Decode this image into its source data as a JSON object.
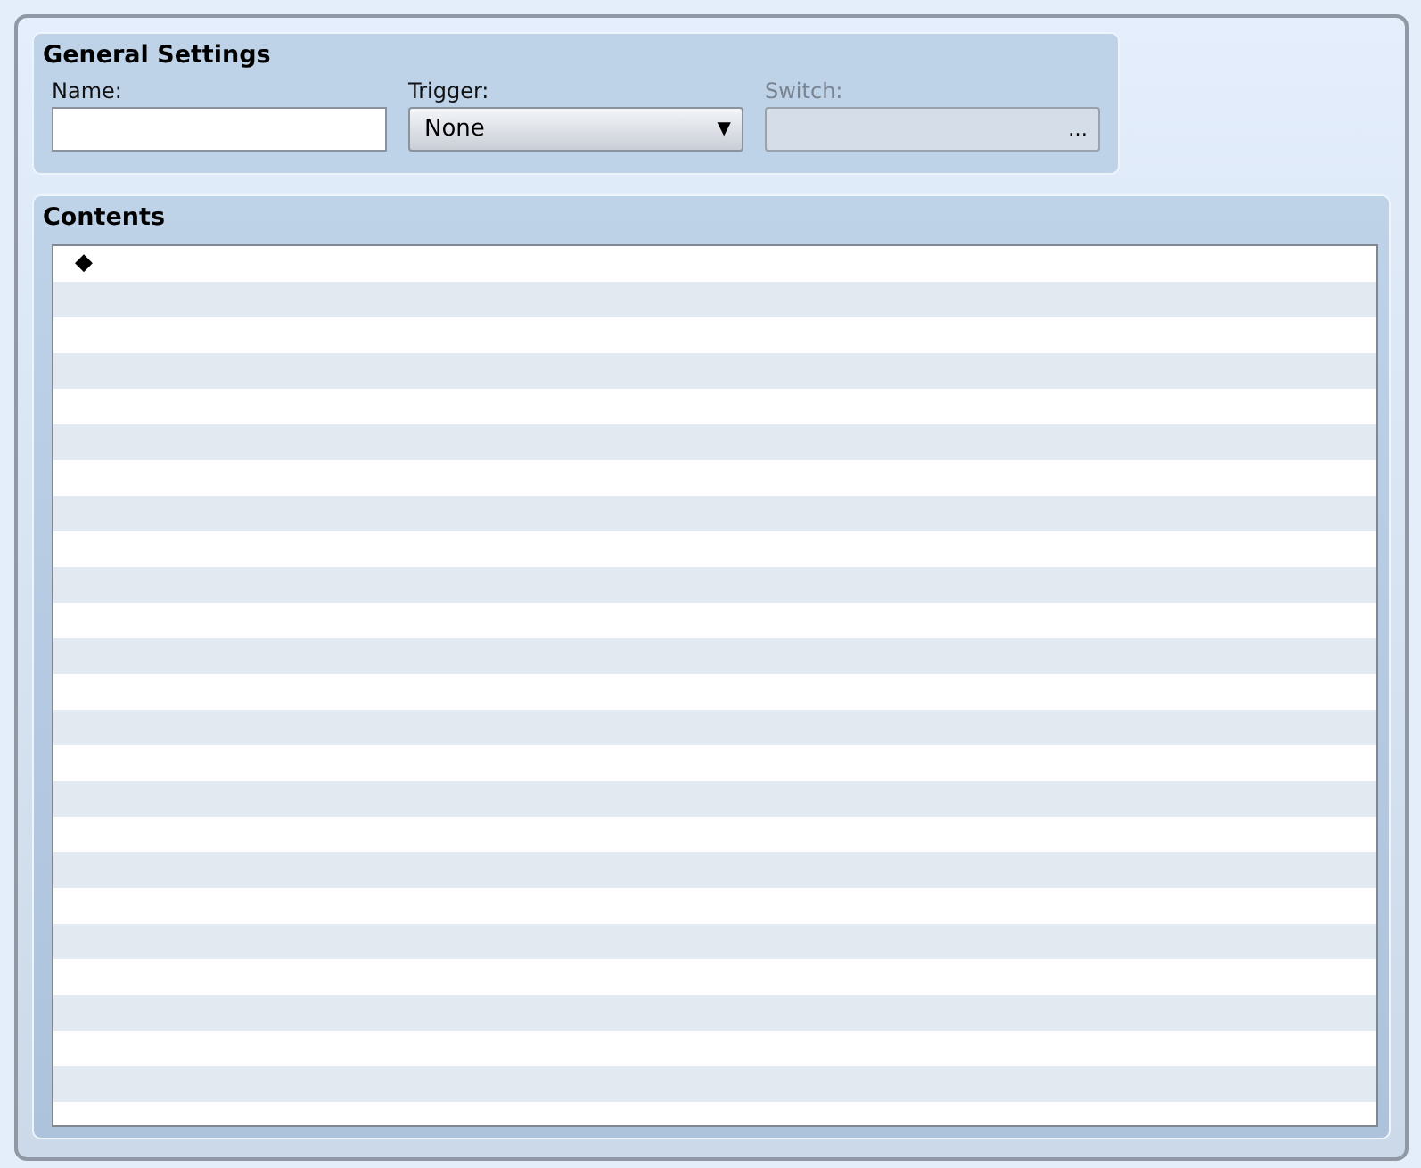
{
  "general_settings": {
    "title": "General Settings",
    "name": {
      "label": "Name:"
    },
    "trigger": {
      "label": "Trigger:",
      "value": "None",
      "arrow": "▼"
    },
    "switch": {
      "label": "Switch:",
      "disabled": true,
      "button": "…"
    }
  },
  "contents": {
    "title": "Contents",
    "items": [
      {
        "marker": "◆",
        "selected": false
      }
    ]
  }
}
